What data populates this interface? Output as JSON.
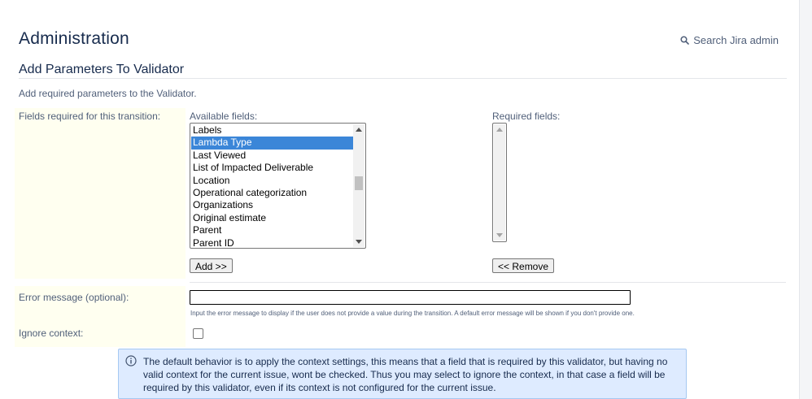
{
  "header": {
    "title": "Administration",
    "search_label": "Search Jira admin",
    "search_icon": "search-icon"
  },
  "section": {
    "title": "Add Parameters To Validator",
    "description": "Add required parameters to the Validator."
  },
  "form": {
    "fields_label": "Fields required for this transition:",
    "available_label": "Available fields:",
    "required_label": "Required fields:",
    "available_options": [
      "Labels",
      "Lambda Type",
      "Last Viewed",
      "List of Impacted Deliverable",
      "Location",
      "Operational categorization",
      "Organizations",
      "Original estimate",
      "Parent",
      "Parent ID"
    ],
    "selected_option": "Lambda Type",
    "required_options": [],
    "add_button": "Add >>",
    "remove_button": "<< Remove",
    "error_label": "Error message (optional):",
    "error_value": "",
    "error_hint": "Input the error message to display if the user does not provide a value during the transition. A default error message will be shown if you don't provide one.",
    "ignore_label": "Ignore context:",
    "ignore_checked": false
  },
  "info": {
    "icon": "info-icon",
    "text": "The default behavior is to apply the context settings, this means that a field that is required by this validator, but having no valid context for the current issue, wont be checked. Thus you may select to ignore the context, in that case a field will be required by this validator, even if its context is not configured for the current issue."
  },
  "colors": {
    "selected_bg": "#3b86d8",
    "label_column_bg": "#fffff0",
    "info_bg": "#deebff",
    "info_border": "#a5c8f2"
  }
}
